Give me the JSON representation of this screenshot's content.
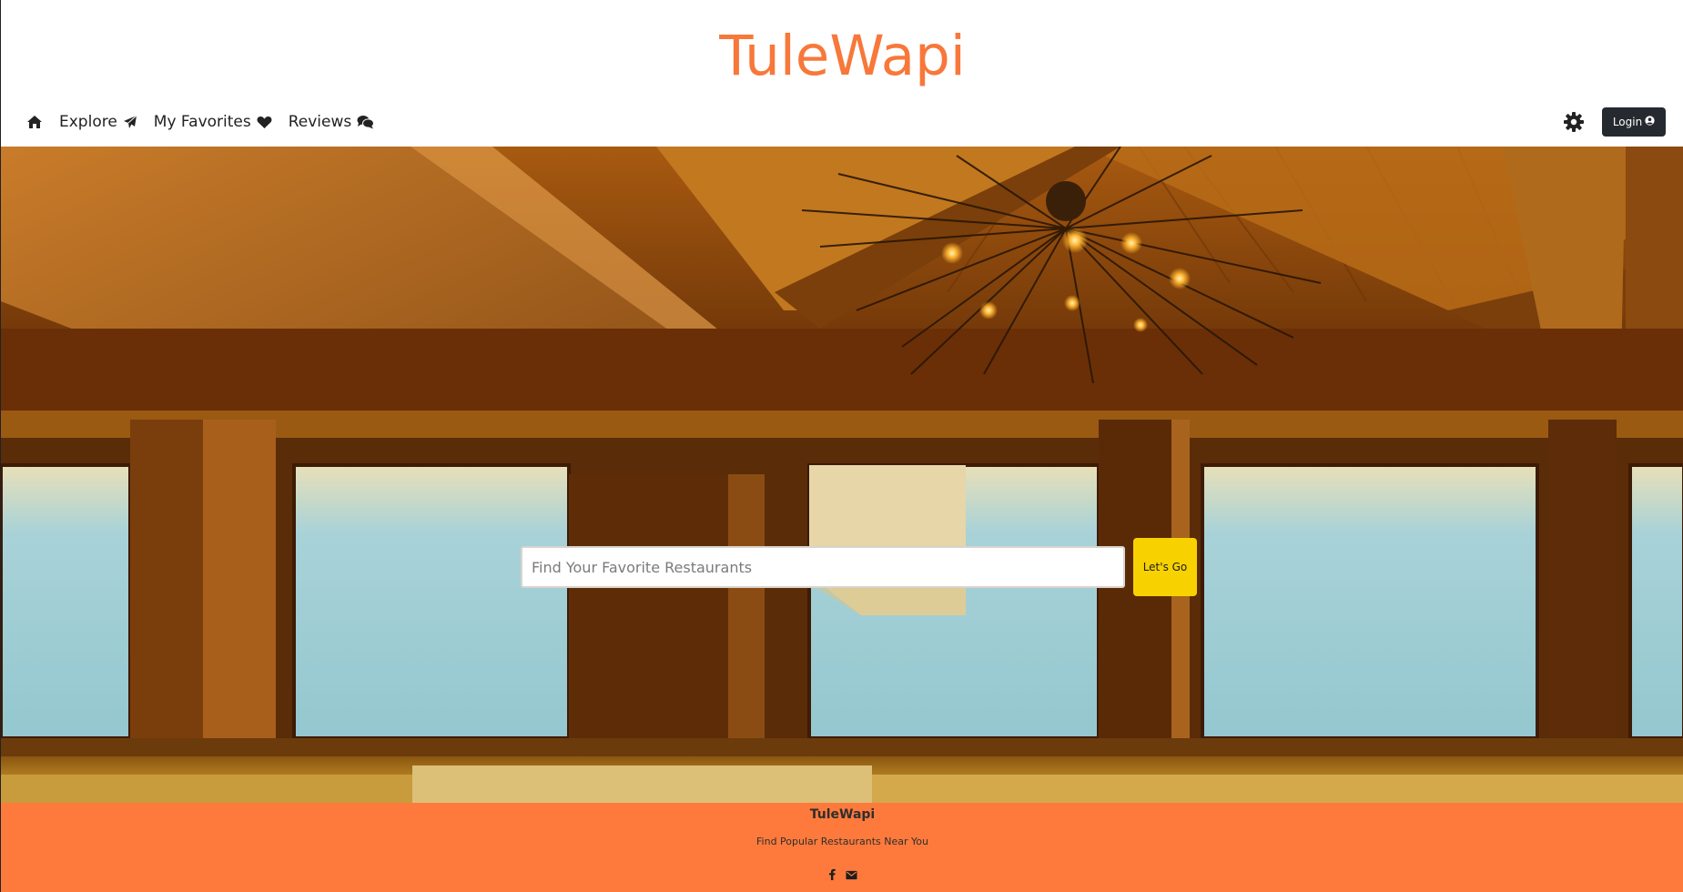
{
  "header": {
    "brand": "TuleWapi"
  },
  "nav": {
    "items": [
      {
        "label": "",
        "icon": "home-icon"
      },
      {
        "label": "Explore",
        "icon": "paper-plane-icon"
      },
      {
        "label": "My Favorites",
        "icon": "heart-icon"
      },
      {
        "label": "Reviews",
        "icon": "comments-icon"
      }
    ],
    "settings_icon": "gear-icon",
    "login_label": "Login",
    "login_icon": "user-circle-icon"
  },
  "hero": {
    "background": "restaurant-interior-wooden-ceiling",
    "search_placeholder": "Find Your Favorite Restaurants",
    "search_value": "",
    "button_label": "Let's Go"
  },
  "footer": {
    "title": "TuleWapi",
    "tagline": "Find Popular Restaurants Near You",
    "icons": [
      "facebook-icon",
      "envelope-icon"
    ]
  },
  "colors": {
    "brand": "#f7783a",
    "footer_bg": "#fd7a3c",
    "cta": "#f7d200",
    "login_bg": "#252a30"
  }
}
